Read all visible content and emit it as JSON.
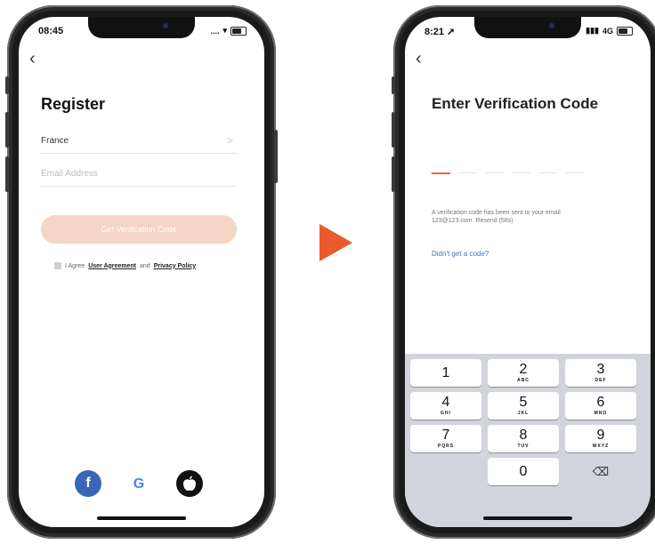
{
  "left_phone": {
    "status_time": "08:45",
    "status_icons": "....",
    "title": "Register",
    "country_value": "France",
    "country_chevron": ">",
    "email_placeholder": "Email Address",
    "get_code_label": "Get Verification Code",
    "agree_prefix": "I Agree",
    "user_agreement": "User Agreement",
    "and_text": "and",
    "privacy_policy": "Privacy Policy",
    "social": [
      {
        "name": "facebook-icon",
        "glyph": "f"
      },
      {
        "name": "google-icon",
        "glyph": "G"
      },
      {
        "name": "apple-icon",
        "glyph": "●"
      }
    ]
  },
  "right_phone": {
    "status_time": "8:21",
    "status_network": "4G",
    "title": "Enter Verification Code",
    "info_line1": "A verification code has been sent to your email",
    "info_email": "123@123.com",
    "resend": "Resend (58s)",
    "didnt_get": "Didn't get a code?",
    "keys": [
      {
        "num": "1",
        "letters": ""
      },
      {
        "num": "2",
        "letters": "ABC"
      },
      {
        "num": "3",
        "letters": "DEF"
      },
      {
        "num": "4",
        "letters": "GHI"
      },
      {
        "num": "5",
        "letters": "JKL"
      },
      {
        "num": "6",
        "letters": "MNO"
      },
      {
        "num": "7",
        "letters": "PQRS"
      },
      {
        "num": "8",
        "letters": "TUV"
      },
      {
        "num": "9",
        "letters": "WXYZ"
      },
      {
        "num": "0",
        "letters": ""
      }
    ],
    "backspace_glyph": "⌫"
  },
  "colors": {
    "accent": "#ea5a2a",
    "button_disabled": "#f5d5c6",
    "link_blue": "#3a78c8",
    "facebook": "#3b66b8"
  }
}
